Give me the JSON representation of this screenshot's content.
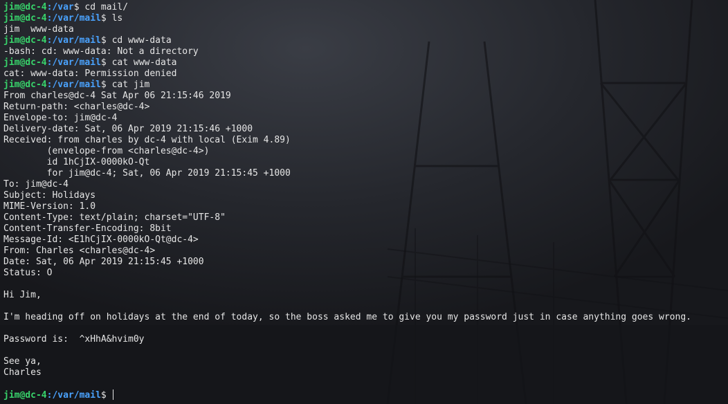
{
  "terminal": {
    "prompt_user_host": "jim@dc-4",
    "colors": {
      "user_host": "#38d36b",
      "path": "#4aa3ff",
      "text": "#e6e6e6",
      "background": "#1e2026"
    },
    "lines": [
      {
        "type": "prompt",
        "path": "/var",
        "symbol": "$",
        "command": "cd mail/"
      },
      {
        "type": "prompt",
        "path": "/var/mail",
        "symbol": "$",
        "command": "ls"
      },
      {
        "type": "output",
        "text": "jim  www-data"
      },
      {
        "type": "prompt",
        "path": "/var/mail",
        "symbol": "$",
        "command": "cd www-data"
      },
      {
        "type": "output",
        "text": "-bash: cd: www-data: Not a directory"
      },
      {
        "type": "prompt",
        "path": "/var/mail",
        "symbol": "$",
        "command": "cat www-data"
      },
      {
        "type": "output",
        "text": "cat: www-data: Permission denied"
      },
      {
        "type": "prompt",
        "path": "/var/mail",
        "symbol": "$",
        "command": "cat jim"
      },
      {
        "type": "output",
        "text": "From charles@dc-4 Sat Apr 06 21:15:46 2019"
      },
      {
        "type": "output",
        "text": "Return-path: <charles@dc-4>"
      },
      {
        "type": "output",
        "text": "Envelope-to: jim@dc-4"
      },
      {
        "type": "output",
        "text": "Delivery-date: Sat, 06 Apr 2019 21:15:46 +1000"
      },
      {
        "type": "output",
        "text": "Received: from charles by dc-4 with local (Exim 4.89)"
      },
      {
        "type": "output",
        "text": "        (envelope-from <charles@dc-4>)"
      },
      {
        "type": "output",
        "text": "        id 1hCjIX-0000kO-Qt"
      },
      {
        "type": "output",
        "text": "        for jim@dc-4; Sat, 06 Apr 2019 21:15:45 +1000"
      },
      {
        "type": "output",
        "text": "To: jim@dc-4"
      },
      {
        "type": "output",
        "text": "Subject: Holidays"
      },
      {
        "type": "output",
        "text": "MIME-Version: 1.0"
      },
      {
        "type": "output",
        "text": "Content-Type: text/plain; charset=\"UTF-8\""
      },
      {
        "type": "output",
        "text": "Content-Transfer-Encoding: 8bit"
      },
      {
        "type": "output",
        "text": "Message-Id: <E1hCjIX-0000kO-Qt@dc-4>"
      },
      {
        "type": "output",
        "text": "From: Charles <charles@dc-4>"
      },
      {
        "type": "output",
        "text": "Date: Sat, 06 Apr 2019 21:15:45 +1000"
      },
      {
        "type": "output",
        "text": "Status: O"
      },
      {
        "type": "output",
        "text": ""
      },
      {
        "type": "output",
        "text": "Hi Jim,"
      },
      {
        "type": "output",
        "text": ""
      },
      {
        "type": "output",
        "text": "I'm heading off on holidays at the end of today, so the boss asked me to give you my password just in case anything goes wrong."
      },
      {
        "type": "output",
        "text": ""
      },
      {
        "type": "output",
        "text": "Password is:  ^xHhA&hvim0y"
      },
      {
        "type": "output",
        "text": ""
      },
      {
        "type": "output",
        "text": "See ya,"
      },
      {
        "type": "output",
        "text": "Charles"
      },
      {
        "type": "output",
        "text": ""
      },
      {
        "type": "prompt",
        "path": "/var/mail",
        "symbol": "$",
        "command": "",
        "cursor": true
      }
    ]
  }
}
